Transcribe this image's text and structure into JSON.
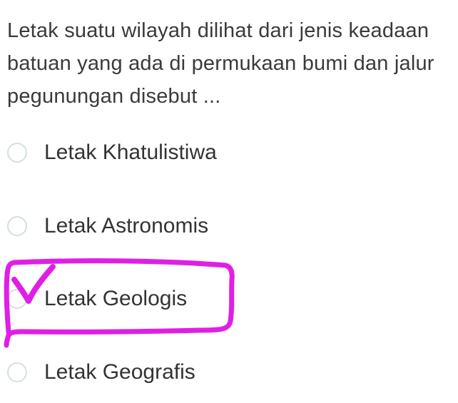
{
  "question": {
    "text": "Letak suatu wilayah dilihat dari jenis keadaan batuan yang ada di permukaan bumi dan jalur pegunungan disebut ..."
  },
  "options": [
    {
      "label": "Letak Khatulistiwa"
    },
    {
      "label": "Letak Astronomis"
    },
    {
      "label": "Letak Geologis"
    },
    {
      "label": "Letak Geografis"
    }
  ],
  "annotation": {
    "marked_option_index": 2,
    "color": "#e01ee6"
  },
  "colors": {
    "text": "#333333",
    "radio_border": "#d3e0e2"
  }
}
